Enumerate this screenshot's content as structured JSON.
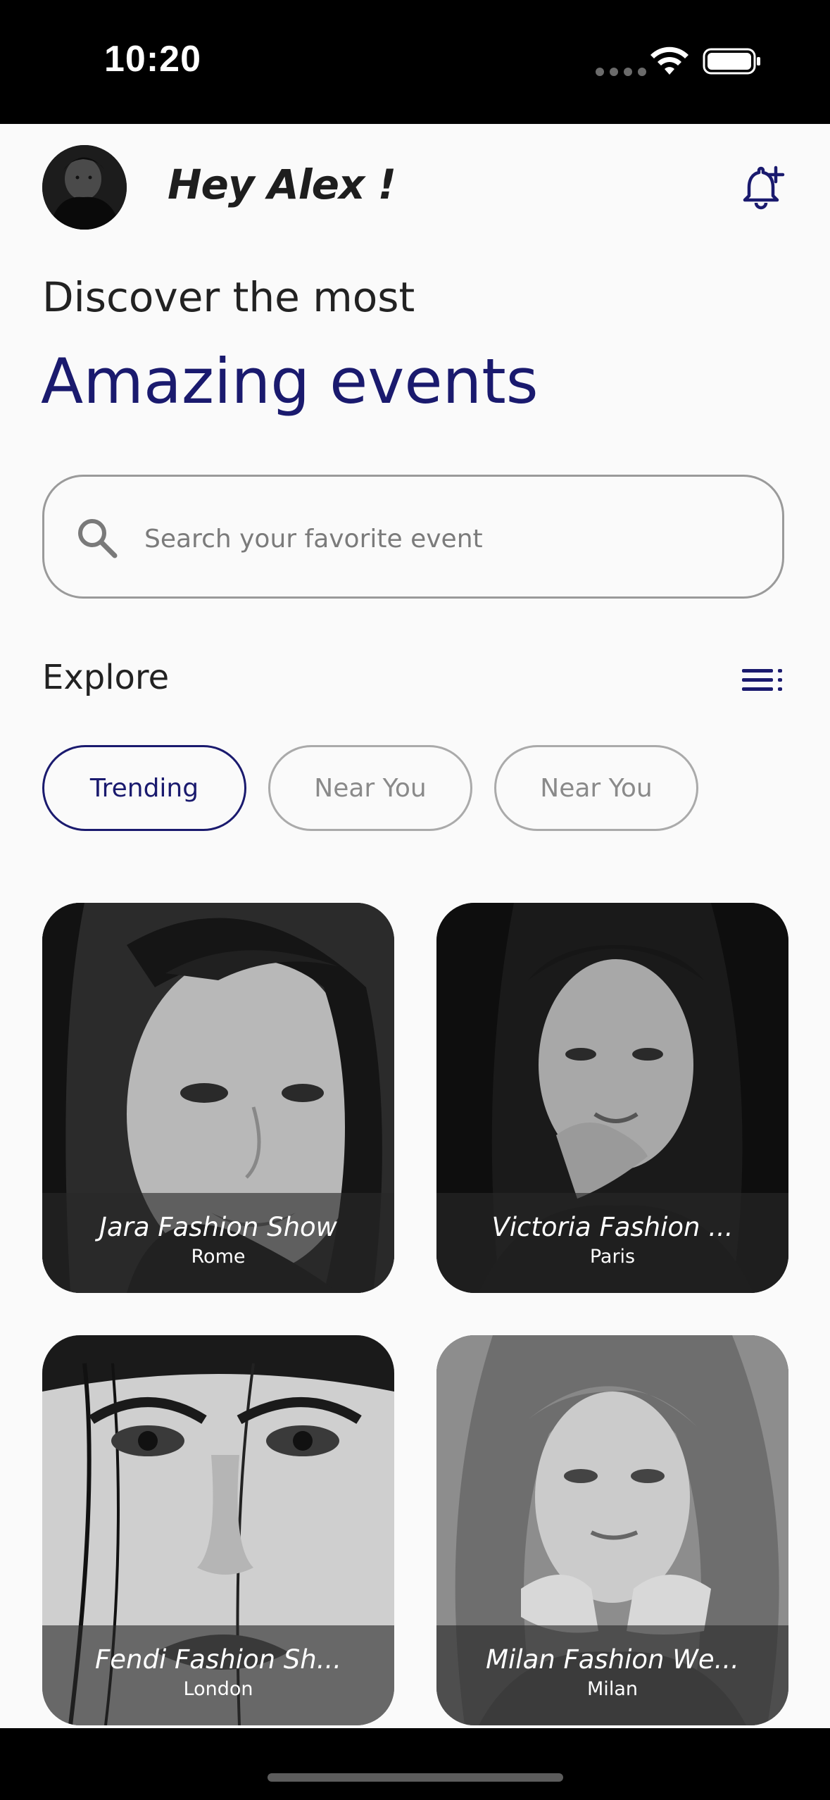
{
  "status_bar": {
    "time": "10:20"
  },
  "header": {
    "greeting": "Hey Alex !"
  },
  "hero": {
    "subtitle": "Discover the most",
    "headline": "Amazing events"
  },
  "search": {
    "placeholder": "Search your favorite event"
  },
  "explore": {
    "label": "Explore"
  },
  "chips": [
    {
      "label": "Trending",
      "active": true
    },
    {
      "label": "Near You",
      "active": false
    },
    {
      "label": "Near You",
      "active": false
    }
  ],
  "events": [
    {
      "title": "Jara Fashion Show",
      "city": "Rome"
    },
    {
      "title": "Victoria Fashion ...",
      "city": "Paris"
    },
    {
      "title": "Fendi Fashion Sh...",
      "city": "London"
    },
    {
      "title": "Milan Fashion We...",
      "city": "Milan"
    }
  ],
  "colors": {
    "accent": "#1a1a6e",
    "background": "#fafafa",
    "status_bar": "#000000"
  }
}
